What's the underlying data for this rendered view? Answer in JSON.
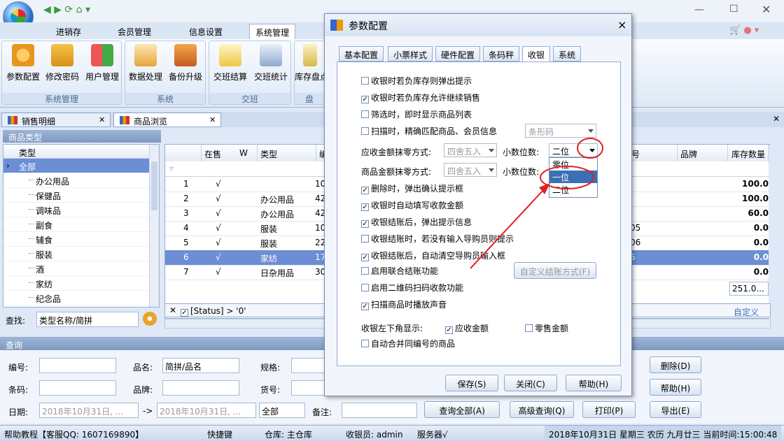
{
  "title_tabs": [
    "进销存",
    "会员管理",
    "信息设置",
    "系统管理"
  ],
  "ribbon": {
    "buttons": [
      "参数配置",
      "修改密码",
      "用户管理",
      "数据处理",
      "备份升级",
      "交班结算",
      "交班统计",
      "库存盘点"
    ],
    "groups": [
      "系统管理",
      "系统",
      "交班",
      "盘"
    ]
  },
  "doc_tabs": [
    "销售明细",
    "商品浏览"
  ],
  "tree": {
    "header": "商品类型",
    "col": "类型",
    "root": "全部",
    "items": [
      "办公用品",
      "保健品",
      "调味品",
      "副食",
      "辅食",
      "服装",
      "酒",
      "家纺",
      "纪念品"
    ],
    "search_label": "查找:",
    "search_value": "类型名称/简拼"
  },
  "grid": {
    "headers": [
      "在售",
      "W",
      "类型",
      "编",
      "号",
      "品牌",
      "库存数量"
    ],
    "rows": [
      {
        "n": "1",
        "sale": "√",
        "type": "",
        "code": "10",
        "num": "",
        "stock": "100.0"
      },
      {
        "n": "2",
        "sale": "√",
        "type": "办公用品",
        "code": "42",
        "num": "",
        "stock": "100.0"
      },
      {
        "n": "3",
        "sale": "√",
        "type": "办公用品",
        "code": "42",
        "num": "",
        "stock": "60.0"
      },
      {
        "n": "4",
        "sale": "√",
        "type": "服装",
        "code": "10",
        "num": "05",
        "stock": "0.0"
      },
      {
        "n": "5",
        "sale": "√",
        "type": "服装",
        "code": "22",
        "num": "06",
        "stock": "0.0"
      },
      {
        "n": "6",
        "sale": "√",
        "type": "家纺",
        "code": "17",
        "num": "5",
        "stock": "0.0"
      },
      {
        "n": "7",
        "sale": "√",
        "type": "日杂用品",
        "code": "30",
        "num": "",
        "stock": "0.0"
      }
    ],
    "total": "251.0...",
    "filter": "[Status] > '0'",
    "custom": "自定义"
  },
  "query": {
    "title": "查询",
    "labels": {
      "code": "编号:",
      "name": "品名:",
      "spec": "规格:",
      "barcode": "条码:",
      "brand": "品牌:",
      "item": "货号:",
      "date": "日期:",
      "note": "备注:"
    },
    "name_value": "简拼/品名",
    "date_from": "2018年10月31日, ...",
    "date_to": "2018年10月31日, ...",
    "arrow": "->",
    "all": "全部",
    "buttons": [
      "查询全部(A)",
      "高级查询(Q)",
      "打印(P)",
      "导出(E)",
      "删除(D)",
      "帮助(H)"
    ]
  },
  "status": {
    "help": "帮助教程【客服QQ: 1607169890】",
    "shortcut": "快捷键",
    "store": "仓库: 主仓库",
    "cashier": "收银员: admin",
    "server": "服务器√",
    "datetime": "2018年10月31日 星期三 农历 九月廿三 当前时间:15:00:48"
  },
  "dialog": {
    "title": "参数配置",
    "close": "×",
    "tabs": [
      "基本配置",
      "小票样式",
      "硬件配置",
      "条码秤",
      "收银",
      "系统"
    ],
    "checks": [
      {
        "label": "收银时若负库存则弹出提示",
        "checked": false
      },
      {
        "label": "收银时若负库存允许继续销售",
        "checked": true
      },
      {
        "label": "筛选时，即时显示商品列表",
        "checked": false
      },
      {
        "label": "扫描时，精确匹配商品、会员信息",
        "checked": false
      },
      {
        "label": "删除时，弹出确认提示框",
        "checked": true
      },
      {
        "label": "收银时自动填写收款金额",
        "checked": true
      },
      {
        "label": "收银结账后，弹出提示信息",
        "checked": true
      },
      {
        "label": "收银结账时，若没有输入导购员则提示",
        "checked": false
      },
      {
        "label": "收银结账后，自动清空导购员输入框",
        "checked": true
      },
      {
        "label": "启用联合结账功能",
        "checked": false
      },
      {
        "label": "启用二维码扫码收款功能",
        "checked": false
      },
      {
        "label": "扫描商品时播放声音",
        "checked": true
      }
    ],
    "barcode_combo": "条形码",
    "recv_round_label": "应收金额抹零方式:",
    "goods_round_label": "商品金额抹零方式:",
    "round_value": "四舍五入",
    "decimals_label": "小数位数:",
    "decimals_value": "二位",
    "decimals_options": [
      "零位",
      "一位",
      "二位"
    ],
    "custom_btn": "自定义结账方式(F)",
    "bottom_label": "收银左下角显示:",
    "show_recv": "应收金额",
    "show_change": "零售金额",
    "merge": "自动合并同编号的商品",
    "buttons": [
      "保存(S)",
      "关闭(C)",
      "帮助(H)"
    ]
  },
  "colors": {
    "accent": "#3c6fb5",
    "selected": "#6c8ed4",
    "annotation": "#e02020"
  }
}
